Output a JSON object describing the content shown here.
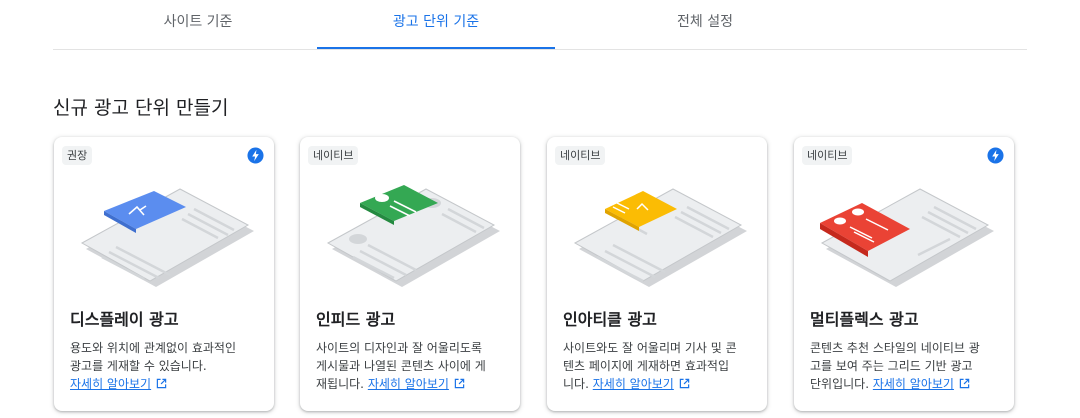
{
  "tabs": [
    {
      "label": "사이트 기준",
      "active": false
    },
    {
      "label": "광고 단위 기준",
      "active": true
    },
    {
      "label": "전체 설정",
      "active": false
    }
  ],
  "section_title": "신규 광고 단위 만들기",
  "learn_more_label": "자세히 알아보기",
  "cards": [
    {
      "badge": "권장",
      "has_bolt": true,
      "title": "디스플레이 광고",
      "desc_lines": [
        "용도와 위치에 관계없이 효과적인",
        "광고를 게재할 수 있습니다."
      ],
      "desc_tail": "",
      "illustration": "display-ad-illustration",
      "accent": "#5b8def"
    },
    {
      "badge": "네이티브",
      "has_bolt": false,
      "title": "인피드 광고",
      "desc_lines": [
        "사이트의 디자인과 잘 어울리도록",
        "게시물과 나열된 콘텐츠 사이에 게"
      ],
      "desc_tail": "재됩니다.",
      "illustration": "in-feed-ad-illustration",
      "accent": "#34a853"
    },
    {
      "badge": "네이티브",
      "has_bolt": false,
      "title": "인아티클 광고",
      "desc_lines": [
        "사이트와도 잘 어울리며 기사 및 콘",
        "텐츠 페이지에 게재하면 효과적입"
      ],
      "desc_tail": "니다.",
      "illustration": "in-article-ad-illustration",
      "accent": "#fbbc04"
    },
    {
      "badge": "네이티브",
      "has_bolt": true,
      "title": "멀티플렉스 광고",
      "desc_lines": [
        "콘텐츠 추천 스타일의 네이티브 광",
        "고를 보여 주는 그리드 기반 광고"
      ],
      "desc_tail": "단위입니다.",
      "illustration": "multiplex-ad-illustration",
      "accent": "#ea4335"
    }
  ],
  "colors": {
    "link": "#1a73e8",
    "bolt": "#1a73e8"
  }
}
